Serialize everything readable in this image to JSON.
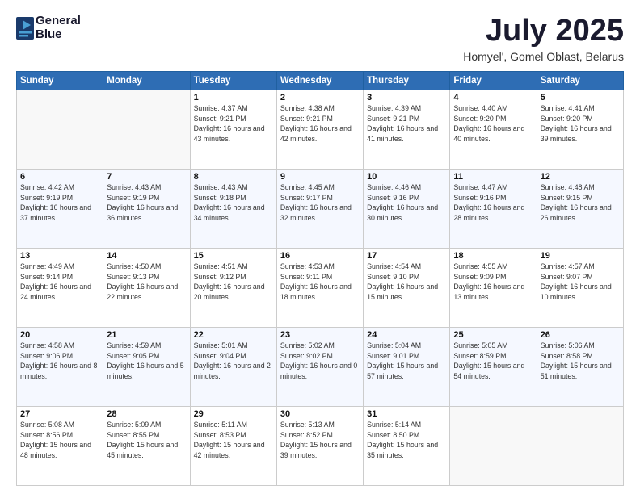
{
  "header": {
    "logo_line1": "General",
    "logo_line2": "Blue",
    "month_title": "July 2025",
    "subtitle": "Homyel', Gomel Oblast, Belarus"
  },
  "weekdays": [
    "Sunday",
    "Monday",
    "Tuesday",
    "Wednesday",
    "Thursday",
    "Friday",
    "Saturday"
  ],
  "weeks": [
    [
      {
        "day": "",
        "sunrise": "",
        "sunset": "",
        "daylight": ""
      },
      {
        "day": "",
        "sunrise": "",
        "sunset": "",
        "daylight": ""
      },
      {
        "day": "1",
        "sunrise": "Sunrise: 4:37 AM",
        "sunset": "Sunset: 9:21 PM",
        "daylight": "Daylight: 16 hours and 43 minutes."
      },
      {
        "day": "2",
        "sunrise": "Sunrise: 4:38 AM",
        "sunset": "Sunset: 9:21 PM",
        "daylight": "Daylight: 16 hours and 42 minutes."
      },
      {
        "day": "3",
        "sunrise": "Sunrise: 4:39 AM",
        "sunset": "Sunset: 9:21 PM",
        "daylight": "Daylight: 16 hours and 41 minutes."
      },
      {
        "day": "4",
        "sunrise": "Sunrise: 4:40 AM",
        "sunset": "Sunset: 9:20 PM",
        "daylight": "Daylight: 16 hours and 40 minutes."
      },
      {
        "day": "5",
        "sunrise": "Sunrise: 4:41 AM",
        "sunset": "Sunset: 9:20 PM",
        "daylight": "Daylight: 16 hours and 39 minutes."
      }
    ],
    [
      {
        "day": "6",
        "sunrise": "Sunrise: 4:42 AM",
        "sunset": "Sunset: 9:19 PM",
        "daylight": "Daylight: 16 hours and 37 minutes."
      },
      {
        "day": "7",
        "sunrise": "Sunrise: 4:43 AM",
        "sunset": "Sunset: 9:19 PM",
        "daylight": "Daylight: 16 hours and 36 minutes."
      },
      {
        "day": "8",
        "sunrise": "Sunrise: 4:43 AM",
        "sunset": "Sunset: 9:18 PM",
        "daylight": "Daylight: 16 hours and 34 minutes."
      },
      {
        "day": "9",
        "sunrise": "Sunrise: 4:45 AM",
        "sunset": "Sunset: 9:17 PM",
        "daylight": "Daylight: 16 hours and 32 minutes."
      },
      {
        "day": "10",
        "sunrise": "Sunrise: 4:46 AM",
        "sunset": "Sunset: 9:16 PM",
        "daylight": "Daylight: 16 hours and 30 minutes."
      },
      {
        "day": "11",
        "sunrise": "Sunrise: 4:47 AM",
        "sunset": "Sunset: 9:16 PM",
        "daylight": "Daylight: 16 hours and 28 minutes."
      },
      {
        "day": "12",
        "sunrise": "Sunrise: 4:48 AM",
        "sunset": "Sunset: 9:15 PM",
        "daylight": "Daylight: 16 hours and 26 minutes."
      }
    ],
    [
      {
        "day": "13",
        "sunrise": "Sunrise: 4:49 AM",
        "sunset": "Sunset: 9:14 PM",
        "daylight": "Daylight: 16 hours and 24 minutes."
      },
      {
        "day": "14",
        "sunrise": "Sunrise: 4:50 AM",
        "sunset": "Sunset: 9:13 PM",
        "daylight": "Daylight: 16 hours and 22 minutes."
      },
      {
        "day": "15",
        "sunrise": "Sunrise: 4:51 AM",
        "sunset": "Sunset: 9:12 PM",
        "daylight": "Daylight: 16 hours and 20 minutes."
      },
      {
        "day": "16",
        "sunrise": "Sunrise: 4:53 AM",
        "sunset": "Sunset: 9:11 PM",
        "daylight": "Daylight: 16 hours and 18 minutes."
      },
      {
        "day": "17",
        "sunrise": "Sunrise: 4:54 AM",
        "sunset": "Sunset: 9:10 PM",
        "daylight": "Daylight: 16 hours and 15 minutes."
      },
      {
        "day": "18",
        "sunrise": "Sunrise: 4:55 AM",
        "sunset": "Sunset: 9:09 PM",
        "daylight": "Daylight: 16 hours and 13 minutes."
      },
      {
        "day": "19",
        "sunrise": "Sunrise: 4:57 AM",
        "sunset": "Sunset: 9:07 PM",
        "daylight": "Daylight: 16 hours and 10 minutes."
      }
    ],
    [
      {
        "day": "20",
        "sunrise": "Sunrise: 4:58 AM",
        "sunset": "Sunset: 9:06 PM",
        "daylight": "Daylight: 16 hours and 8 minutes."
      },
      {
        "day": "21",
        "sunrise": "Sunrise: 4:59 AM",
        "sunset": "Sunset: 9:05 PM",
        "daylight": "Daylight: 16 hours and 5 minutes."
      },
      {
        "day": "22",
        "sunrise": "Sunrise: 5:01 AM",
        "sunset": "Sunset: 9:04 PM",
        "daylight": "Daylight: 16 hours and 2 minutes."
      },
      {
        "day": "23",
        "sunrise": "Sunrise: 5:02 AM",
        "sunset": "Sunset: 9:02 PM",
        "daylight": "Daylight: 16 hours and 0 minutes."
      },
      {
        "day": "24",
        "sunrise": "Sunrise: 5:04 AM",
        "sunset": "Sunset: 9:01 PM",
        "daylight": "Daylight: 15 hours and 57 minutes."
      },
      {
        "day": "25",
        "sunrise": "Sunrise: 5:05 AM",
        "sunset": "Sunset: 8:59 PM",
        "daylight": "Daylight: 15 hours and 54 minutes."
      },
      {
        "day": "26",
        "sunrise": "Sunrise: 5:06 AM",
        "sunset": "Sunset: 8:58 PM",
        "daylight": "Daylight: 15 hours and 51 minutes."
      }
    ],
    [
      {
        "day": "27",
        "sunrise": "Sunrise: 5:08 AM",
        "sunset": "Sunset: 8:56 PM",
        "daylight": "Daylight: 15 hours and 48 minutes."
      },
      {
        "day": "28",
        "sunrise": "Sunrise: 5:09 AM",
        "sunset": "Sunset: 8:55 PM",
        "daylight": "Daylight: 15 hours and 45 minutes."
      },
      {
        "day": "29",
        "sunrise": "Sunrise: 5:11 AM",
        "sunset": "Sunset: 8:53 PM",
        "daylight": "Daylight: 15 hours and 42 minutes."
      },
      {
        "day": "30",
        "sunrise": "Sunrise: 5:13 AM",
        "sunset": "Sunset: 8:52 PM",
        "daylight": "Daylight: 15 hours and 39 minutes."
      },
      {
        "day": "31",
        "sunrise": "Sunrise: 5:14 AM",
        "sunset": "Sunset: 8:50 PM",
        "daylight": "Daylight: 15 hours and 35 minutes."
      },
      {
        "day": "",
        "sunrise": "",
        "sunset": "",
        "daylight": ""
      },
      {
        "day": "",
        "sunrise": "",
        "sunset": "",
        "daylight": ""
      }
    ]
  ]
}
